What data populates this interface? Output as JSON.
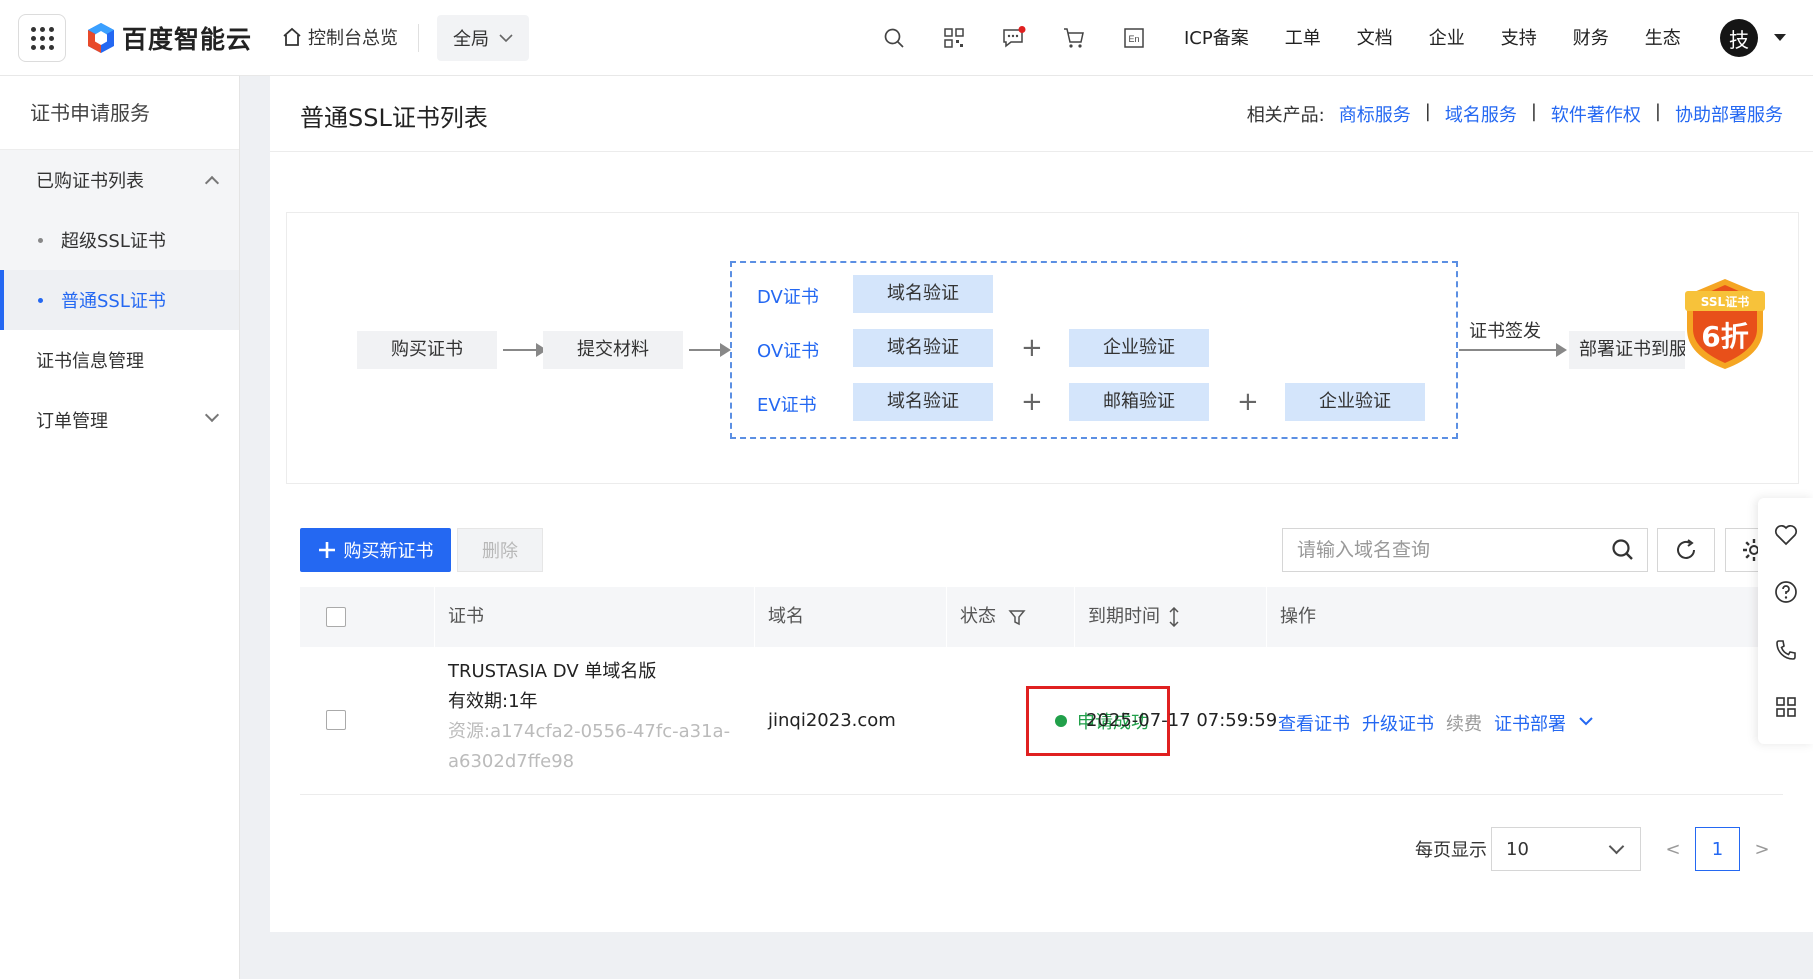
{
  "topbar": {
    "logo_text": "百度智能云",
    "home_label": "控制台总览",
    "region": "全局",
    "icons": [
      "search-icon",
      "qrcode-icon",
      "message-icon",
      "cart-icon",
      "language-icon"
    ],
    "links": [
      "ICP备案",
      "工单",
      "文档",
      "企业",
      "支持",
      "财务",
      "生态"
    ],
    "avatar_char": "技"
  },
  "sidebar": {
    "title": "证书申请服务",
    "items": [
      {
        "label": "已购证书列表",
        "expanded": true,
        "children": [
          {
            "label": "超级SSL证书",
            "active": false
          },
          {
            "label": "普通SSL证书",
            "active": true
          }
        ]
      },
      {
        "label": "证书信息管理"
      },
      {
        "label": "订单管理",
        "expanded": false
      }
    ]
  },
  "page": {
    "title": "普通SSL证书列表",
    "related_label": "相关产品:",
    "related_links": [
      "商标服务",
      "域名服务",
      "软件著作权",
      "协助部署服务"
    ]
  },
  "flow": {
    "step_buy": "购买证书",
    "step_submit": "提交材料",
    "dv_label": "DV证书",
    "ov_label": "OV证书",
    "ev_label": "EV证书",
    "domain_verify": "域名验证",
    "enterprise_verify": "企业验证",
    "email_verify": "邮箱验证",
    "plus": "+",
    "issue_label": "证书签发",
    "step_deploy": "部署证书到服",
    "badge_title": "SSL证书",
    "badge_discount": "6折"
  },
  "toolbar": {
    "buy_label": "购买新证书",
    "delete_label": "删除",
    "search_placeholder": "请输入域名查询"
  },
  "table": {
    "headers": {
      "cert": "证书",
      "domain": "域名",
      "status": "状态",
      "expire": "到期时间",
      "ops": "操作"
    },
    "rows": [
      {
        "cert_name": "TRUSTASIA DV 单域名版",
        "validity": "有效期:1年",
        "source_line1": "资源:a174cfa2-0556-47fc-a31a-",
        "source_line2": "a6302d7ffe98",
        "domain": "jinqi2023.com",
        "status": "申请成功",
        "expire": "2025-07-17 07:59:59",
        "ops": {
          "view": "查看证书",
          "upgrade": "升级证书",
          "renew": "续费",
          "deploy": "证书部署"
        }
      }
    ]
  },
  "pager": {
    "size_label": "每页显示",
    "size_value": "10",
    "prev": "<",
    "current": "1",
    "next": ">"
  },
  "colors": {
    "accent": "#2468f2",
    "success": "#21a04a",
    "highlight": "#e02020"
  }
}
